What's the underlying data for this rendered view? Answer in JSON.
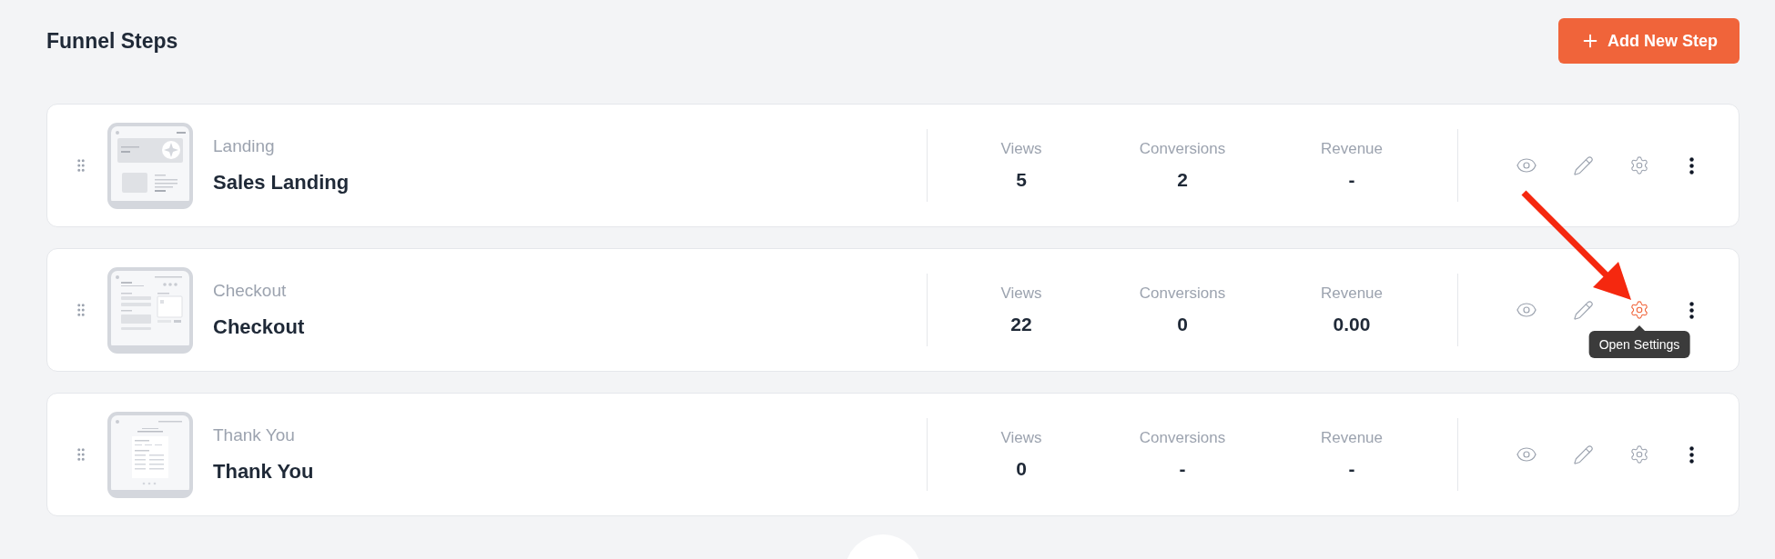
{
  "header": {
    "title": "Funnel Steps",
    "add_button": "Add New Step"
  },
  "steps": [
    {
      "kind": "landing",
      "type_label": "Landing",
      "name": "Sales Landing",
      "stats": [
        {
          "label": "Views",
          "value": "5"
        },
        {
          "label": "Conversions",
          "value": "2"
        },
        {
          "label": "Revenue",
          "value": "-"
        }
      ],
      "settings_hovered": false
    },
    {
      "kind": "checkout",
      "type_label": "Checkout",
      "name": "Checkout",
      "stats": [
        {
          "label": "Views",
          "value": "22"
        },
        {
          "label": "Conversions",
          "value": "0"
        },
        {
          "label": "Revenue",
          "value": "0.00"
        }
      ],
      "settings_hovered": true,
      "settings_tooltip": "Open Settings"
    },
    {
      "kind": "thank_you",
      "type_label": "Thank You",
      "name": "Thank You",
      "stats": [
        {
          "label": "Views",
          "value": "0"
        },
        {
          "label": "Conversions",
          "value": "-"
        },
        {
          "label": "Revenue",
          "value": "-"
        }
      ],
      "settings_hovered": false
    }
  ]
}
